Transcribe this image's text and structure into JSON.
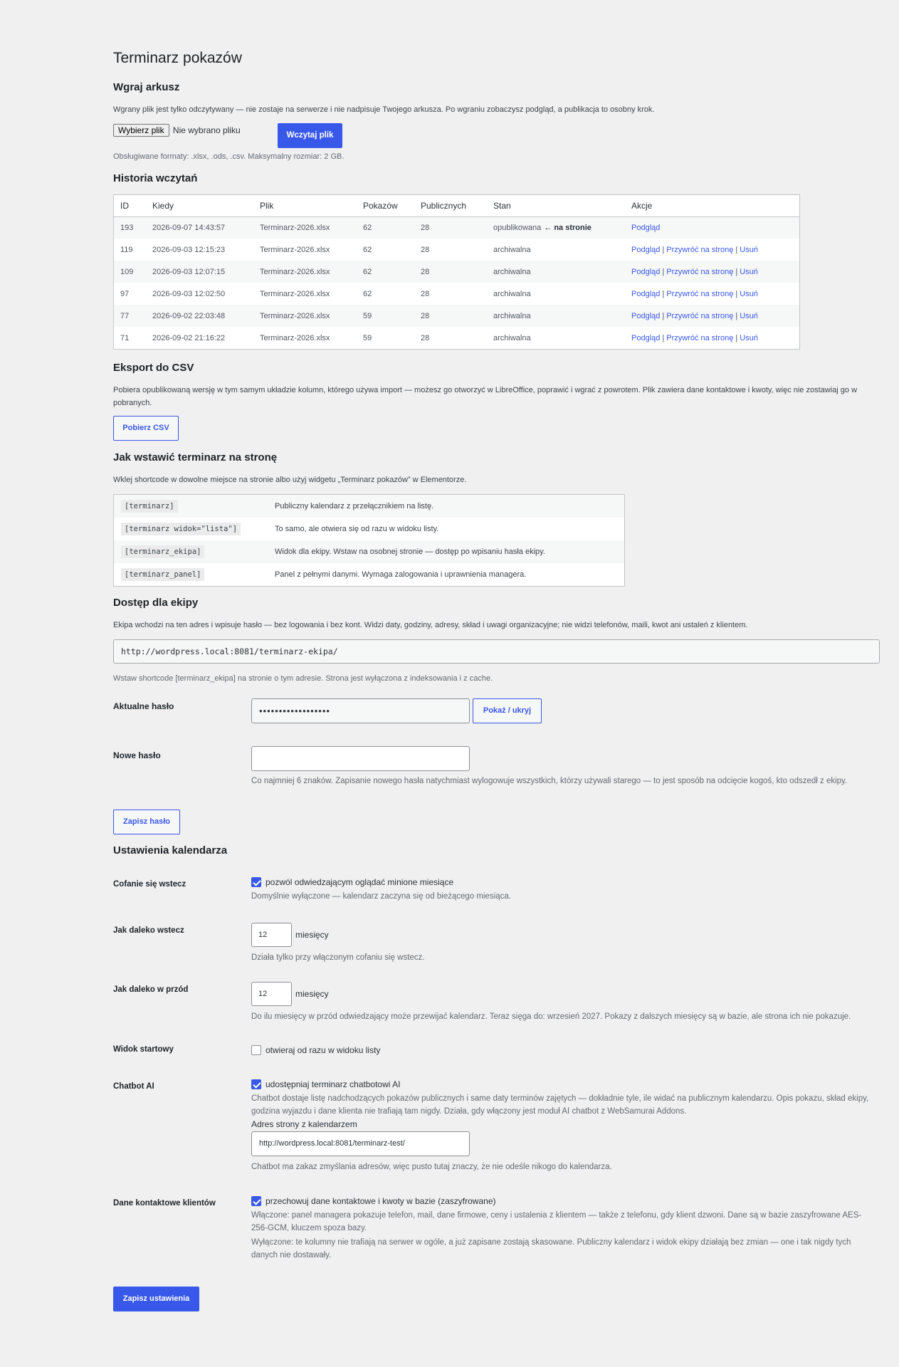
{
  "title": "Terminarz pokazów",
  "upload": {
    "heading": "Wgraj arkusz",
    "intro": "Wgrany plik jest tylko odczytywany — nie zostaje na serwerze i nie nadpisuje Twojego arkusza. Po wgraniu zobaczysz podgląd, a publikacja to osobny krok.",
    "file_button": "Wybierz plik",
    "file_status": "Nie wybrano pliku",
    "submit_label": "Wczytaj plik",
    "formats_note": "Obsługiwane formaty: .xlsx, .ods, .csv. Maksymalny rozmiar: 2 GB."
  },
  "history": {
    "heading": "Historia wczytań",
    "columns": [
      "ID",
      "Kiedy",
      "Plik",
      "Pokazów",
      "Publicznych",
      "Stan",
      "Akcje"
    ],
    "rows": [
      {
        "id": "193",
        "when": "2026-09-07 14:43:57",
        "file": "Terminarz-2026.xlsx",
        "shows": "62",
        "public": "28",
        "state": "opublikowana",
        "state_suffix": "← na stronie",
        "actions": [
          "Podgląd"
        ]
      },
      {
        "id": "119",
        "when": "2026-09-03 12:15:23",
        "file": "Terminarz-2026.xlsx",
        "shows": "62",
        "public": "28",
        "state": "archiwalna",
        "state_suffix": "",
        "actions": [
          "Podgląd",
          "Przywróć na stronę",
          "Usuń"
        ]
      },
      {
        "id": "109",
        "when": "2026-09-03 12:07:15",
        "file": "Terminarz-2026.xlsx",
        "shows": "62",
        "public": "28",
        "state": "archiwalna",
        "state_suffix": "",
        "actions": [
          "Podgląd",
          "Przywróć na stronę",
          "Usuń"
        ]
      },
      {
        "id": "97",
        "when": "2026-09-03 12:02:50",
        "file": "Terminarz-2026.xlsx",
        "shows": "62",
        "public": "28",
        "state": "archiwalna",
        "state_suffix": "",
        "actions": [
          "Podgląd",
          "Przywróć na stronę",
          "Usuń"
        ]
      },
      {
        "id": "77",
        "when": "2026-09-02 22:03:48",
        "file": "Terminarz-2026.xlsx",
        "shows": "59",
        "public": "28",
        "state": "archiwalna",
        "state_suffix": "",
        "actions": [
          "Podgląd",
          "Przywróć na stronę",
          "Usuń"
        ]
      },
      {
        "id": "71",
        "when": "2026-09-02 21:16:22",
        "file": "Terminarz-2026.xlsx",
        "shows": "59",
        "public": "28",
        "state": "archiwalna",
        "state_suffix": "",
        "actions": [
          "Podgląd",
          "Przywróć na stronę",
          "Usuń"
        ]
      }
    ]
  },
  "export": {
    "heading": "Eksport do CSV",
    "intro": "Pobiera opublikowaną wersję w tym samym układzie kolumn, którego używa import — możesz go otworzyć w LibreOffice, poprawić i wgrać z powrotem. Plik zawiera dane kontaktowe i kwoty, więc nie zostawiaj go w pobranych.",
    "button": "Pobierz CSV"
  },
  "embed": {
    "heading": "Jak wstawić terminarz na stronę",
    "intro": "Wklej shortcode w dowolne miejsce na stronie albo użyj widgetu „Terminarz pokazów” w Elementorze.",
    "rows": [
      {
        "code": "[terminarz]",
        "desc": "Publiczny kalendarz z przełącznikiem na listę."
      },
      {
        "code": "[terminarz widok=\"lista\"]",
        "desc": "To samo, ale otwiera się od razu w widoku listy."
      },
      {
        "code": "[terminarz_ekipa]",
        "desc": "Widok dla ekipy. Wstaw na osobnej stronie — dostęp po wpisaniu hasła ekipy."
      },
      {
        "code": "[terminarz_panel]",
        "desc": "Panel z pełnymi danymi. Wymaga zalogowania i uprawnienia managera."
      }
    ]
  },
  "crew": {
    "heading": "Dostęp dla ekipy",
    "intro": "Ekipa wchodzi na ten adres i wpisuje hasło — bez logowania i bez kont. Widzi daty, godziny, adresy, skład i uwagi organizacyjne; nie widzi telefonów, maili, kwot ani ustaleń z klientem.",
    "url": "http://wordpress.local:8081/terminarz-ekipa/",
    "url_note": "Wstaw shortcode [terminarz_ekipa] na stronie o tym adresie. Strona jest wyłączona z indeksowania i z cache.",
    "current_label": "Aktualne hasło",
    "current_value": "••••••••••••••••••",
    "toggle_button": "Pokaż / ukryj",
    "new_label": "Nowe hasło",
    "new_value": "",
    "new_note": "Co najmniej 6 znaków. Zapisanie nowego hasła natychmiast wylogowuje wszystkich, którzy używali starego — to jest sposób na odcięcie kogoś, kto odszedł z ekipy.",
    "save_button": "Zapisz hasło"
  },
  "settings": {
    "heading": "Ustawienia kalendarza",
    "back_label": "Cofanie się wstecz",
    "back_checkbox": "pozwól odwiedzającym oglądać minione miesiące",
    "back_checked": true,
    "back_note": "Domyślnie wyłączone — kalendarz zaczyna się od bieżącego miesiąca.",
    "back_range_label": "Jak daleko wstecz",
    "back_range_value": "12",
    "back_range_unit": "miesięcy",
    "back_range_note": "Działa tylko przy włączonym cofaniu się wstecz.",
    "fwd_range_label": "Jak daleko w przód",
    "fwd_range_value": "12",
    "fwd_range_unit": "miesięcy",
    "fwd_range_note": "Do ilu miesięcy w przód odwiedzający może przewijać kalendarz. Teraz sięga do: wrzesień 2027. Pokazy z dalszych miesięcy są w bazie, ale strona ich nie pokazuje.",
    "start_view_label": "Widok startowy",
    "start_view_checkbox": "otwieraj od razu w widoku listy",
    "start_view_checked": false,
    "chatbot_label": "Chatbot AI",
    "chatbot_checkbox": "udostępniaj terminarz chatbotowi AI",
    "chatbot_checked": true,
    "chatbot_note": "Chatbot dostaje listę nadchodzących pokazów publicznych i same daty terminów zajętych — dokładnie tyle, ile widać na publicznym kalendarzu. Opis pokazu, skład ekipy, godzina wyjazdu i dane klienta nie trafiają tam nigdy. Działa, gdy włączony jest moduł AI chatbot z WebSamurai Addons.",
    "chatbot_url_label": "Adres strony z kalendarzem",
    "chatbot_url_value": "http://wordpress.local:8081/terminarz-test/",
    "chatbot_url_note": "Chatbot ma zakaz zmyślania adresów, więc pusto tutaj znaczy, że nie odeśle nikogo do kalendarza.",
    "contact_label": "Dane kontaktowe klientów",
    "contact_checkbox": "przechowuj dane kontaktowe i kwoty w bazie (zaszyfrowane)",
    "contact_checked": true,
    "contact_note_on": "Włączone: panel managera pokazuje telefon, mail, dane firmowe, ceny i ustalenia z klientem — także z telefonu, gdy klient dzwoni. Dane są w bazie zaszyfrowane AES-256-GCM, kluczem spoza bazy.",
    "contact_note_off": "Wyłączone: te kolumny nie trafiają na serwer w ogóle, a już zapisane zostają skasowane. Publiczny kalendarz i widok ekipy działają bez zmian — one i tak nigdy tych danych nie dostawały.",
    "save_button": "Zapisz ustawienia"
  },
  "colors": {
    "accent": "#3858e9",
    "background": "#f0f0f1",
    "text": "#3c434a"
  }
}
